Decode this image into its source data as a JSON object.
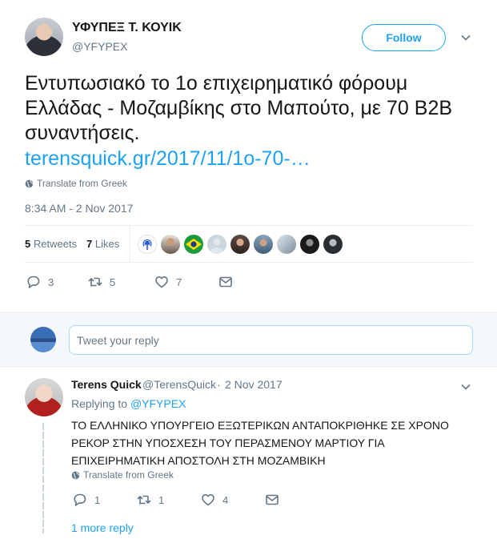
{
  "tweet": {
    "author_name": "ΥΦΥΠΕΞ Τ. ΚΟΥΙΚ",
    "author_handle": "@YFYPEX",
    "follow_label": "Follow",
    "text": "Εντυπωσιακό το 1ο επιχειρηματικό φόρουμ Ελλάδας - Μοζαμβίκης στο Μαπούτο, με 70 B2B συναντήσεις.",
    "link_text": "terensquick.gr/2017/11/1o-70-…",
    "translate_label": "Translate from Greek",
    "timestamp": "8:34 AM - 2 Nov 2017",
    "retweets_count": "5",
    "retweets_label": "Retweets",
    "likes_count": "7",
    "likes_label": "Likes",
    "actions": {
      "reply_count": "3",
      "retweet_count": "5",
      "like_count": "7"
    }
  },
  "composer": {
    "placeholder": "Tweet your reply"
  },
  "reply": {
    "author_name": "Terens Quick",
    "author_handle": "@TerensQuick",
    "separator": "·",
    "date": "2 Nov 2017",
    "replying_prefix": "Replying to",
    "replying_to": "@YFYPEX",
    "text": "ΤΟ ΕΛΛΗΝΙΚΟ ΥΠΟΥΡΓΕΙΟ ΕΞΩΤΕΡΙΚΩΝ ΑΝΤΑΠΟΚΡΙΘΗΚΕ ΣΕ ΧΡΟΝΟ ΡΕΚΟΡ ΣΤΗΝ ΥΠΟΣΧΕΣΗ ΤΟΥ ΠΕΡΑΣΜΕΝΟΥ ΜΑΡΤΙΟΥ ΓΙΑ ΕΠΙΧΕΙΡΗΜΑΤΙΚΗ ΑΠΟΣΤΟΛΗ ΣΤΗ ΜΟΖΑΜΒΙΚΗ",
    "translate_label": "Translate from Greek",
    "actions": {
      "reply_count": "1",
      "retweet_count": "1",
      "like_count": "4"
    },
    "more_replies_label": "1 more reply"
  },
  "colors": {
    "accent": "#1da1f2",
    "secondary_text": "#657786",
    "primary_text": "#14171a",
    "divider": "#e6ecf0",
    "composer_bg": "#f5f8fa"
  },
  "liker_avatars": [
    "podcast-icon-avatar",
    "user-avatar",
    "brazil-flag-avatar",
    "default-avatar",
    "user-avatar",
    "user-avatar",
    "user-avatar",
    "user-avatar",
    "user-avatar"
  ]
}
